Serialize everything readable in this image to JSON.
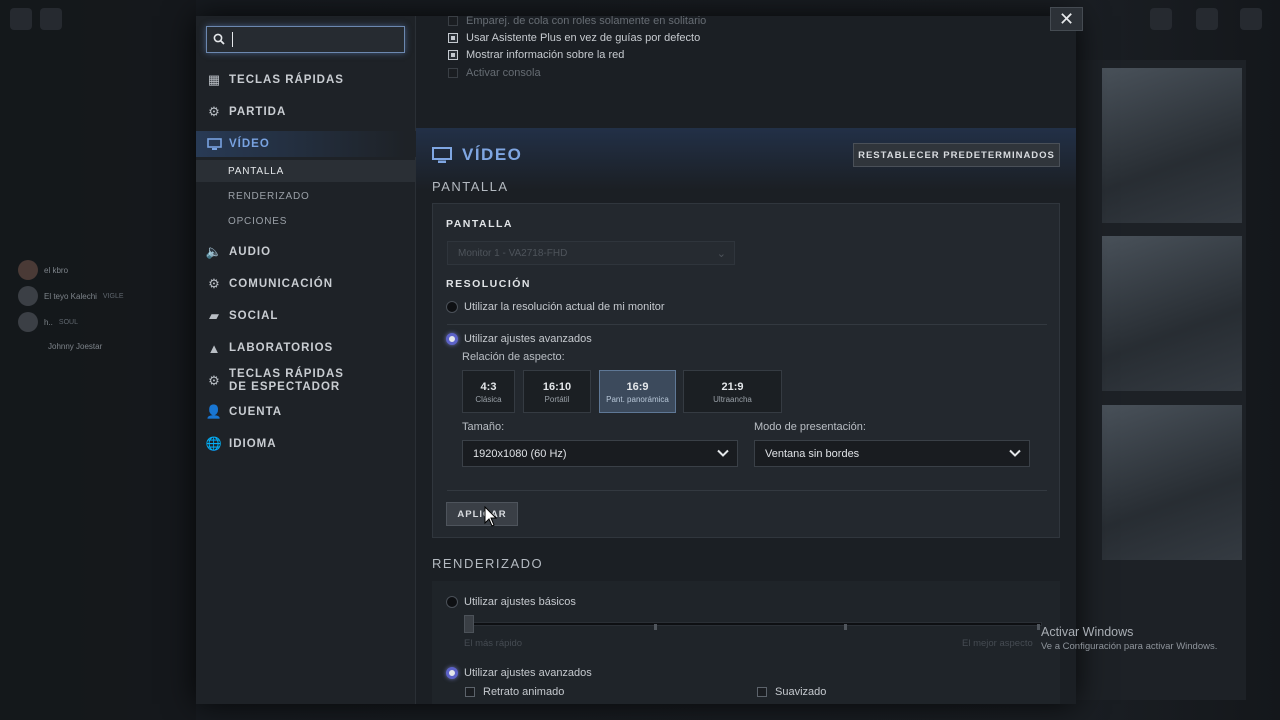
{
  "background": {
    "feed": [
      {
        "name": "el kbro",
        "tag": ""
      },
      {
        "name": "El teyo Kalechi",
        "tag": "VIGLE"
      },
      {
        "name": "h..",
        "tag": "SOUL"
      },
      {
        "name": "Johnny Joestar",
        "tag": ""
      }
    ]
  },
  "search": {
    "value": "",
    "placeholder": ""
  },
  "sidebar": {
    "items": [
      {
        "label": "TECLAS RÁPIDAS",
        "icon": "grid-icon"
      },
      {
        "label": "PARTIDA",
        "icon": "gear-box-icon"
      },
      {
        "label": "VÍDEO",
        "icon": "monitor-icon"
      },
      {
        "label": "AUDIO",
        "icon": "speaker-icon"
      },
      {
        "label": "COMUNICACIÓN",
        "icon": "gear-icon"
      },
      {
        "label": "SOCIAL",
        "icon": "chat-icon"
      },
      {
        "label": "LABORATORIOS",
        "icon": "flask-icon"
      },
      {
        "label": "TECLAS RÁPIDAS DE ESPECTADOR",
        "icon": "eye-gear-icon"
      },
      {
        "label": "CUENTA",
        "icon": "user-icon"
      },
      {
        "label": "IDIOMA",
        "icon": "globe-icon"
      }
    ],
    "video_subitems": [
      "PANTALLA",
      "RENDERIZADO",
      "OPCIONES"
    ]
  },
  "previous_options": [
    {
      "label": "Emparej. de cola con roles solamente en solitario",
      "checked": false,
      "enabled": true
    },
    {
      "label": "Usar Asistente Plus en vez de guías por defecto",
      "checked": true,
      "enabled": true
    },
    {
      "label": "Mostrar información sobre la red",
      "checked": true,
      "enabled": true
    },
    {
      "label": "Activar consola",
      "checked": false,
      "enabled": false
    }
  ],
  "video": {
    "title": "VÍDEO",
    "reset_label": "RESTABLECER PREDETERMINADOS",
    "pantalla_heading": "PANTALLA",
    "panel": {
      "display_label": "PANTALLA",
      "monitor_value": "Monitor 1 - VA2718-FHD",
      "resolution_label": "RESOLUCIÓN",
      "radio_current": "Utilizar la resolución actual de mi monitor",
      "radio_advanced": "Utilizar ajustes avanzados",
      "aspect_label": "Relación de aspecto:",
      "aspects": [
        {
          "ratio": "4:3",
          "name": "Clásica",
          "selected": false
        },
        {
          "ratio": "16:10",
          "name": "Portátil",
          "selected": false
        },
        {
          "ratio": "16:9",
          "name": "Pant. panorámica",
          "selected": true
        },
        {
          "ratio": "21:9",
          "name": "Ultraancha",
          "selected": false
        }
      ],
      "size_label": "Tamaño:",
      "size_value": "1920x1080 (60 Hz)",
      "mode_label": "Modo de presentación:",
      "mode_value": "Ventana sin bordes",
      "apply_label": "APLICAR"
    },
    "render": {
      "heading": "RENDERIZADO",
      "radio_basic": "Utilizar ajustes básicos",
      "slider_min": "El más rápido",
      "slider_max": "El mejor aspecto",
      "radio_advanced": "Utilizar ajustes avanzados",
      "checkbox_1": "Retrato animado",
      "checkbox_2": "Suavizado"
    }
  },
  "watermark": {
    "line1": "Activar Windows",
    "line2": "Ve a Configuración para activar Windows."
  }
}
